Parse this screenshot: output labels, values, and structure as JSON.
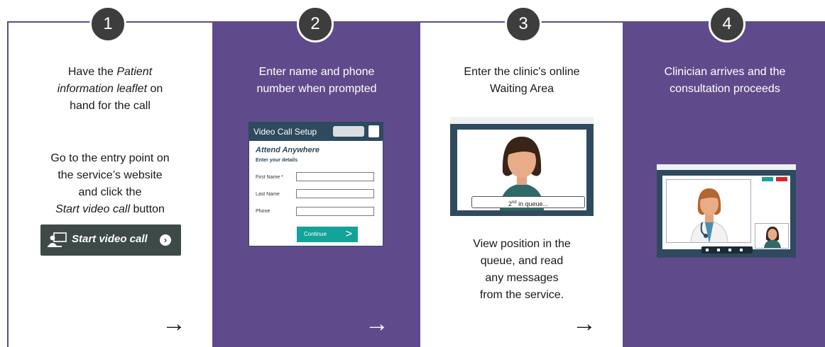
{
  "steps": [
    {
      "number": "1",
      "lines": [
        "Have the ",
        "Patient",
        "information leaflet",
        " on",
        "hand for the call"
      ],
      "sub_lines": [
        "Go to the entry point on",
        "the service’s website",
        "and click the",
        "Start video call",
        " button"
      ],
      "button_label": "Start video call"
    },
    {
      "number": "2",
      "lines": [
        "Enter name and phone",
        "number when prompted"
      ],
      "form": {
        "title": "Video Call Setup",
        "brand": "Attend Anywhere",
        "subtitle": "Enter your details",
        "fields": [
          "First Name *",
          "Last Name",
          "Phone"
        ],
        "continue_label": "Continue"
      }
    },
    {
      "number": "3",
      "lines": [
        "Enter the clinic's online",
        "Waiting Area"
      ],
      "queue_ordinal": "2",
      "queue_suffix": "nd",
      "queue_text": " in queue...",
      "sub_lines": [
        "View position in the",
        "queue, and read",
        "any messages",
        "from the service."
      ]
    },
    {
      "number": "4",
      "lines": [
        "Clinician arrives and the",
        "consultation proceeds"
      ]
    }
  ],
  "arrow_glyph": "→",
  "colors": {
    "purple": "#5f4b8b",
    "badge": "#3d3d3d",
    "screen": "#2f4a5e",
    "teal": "#14a39a",
    "red": "#e02020"
  }
}
